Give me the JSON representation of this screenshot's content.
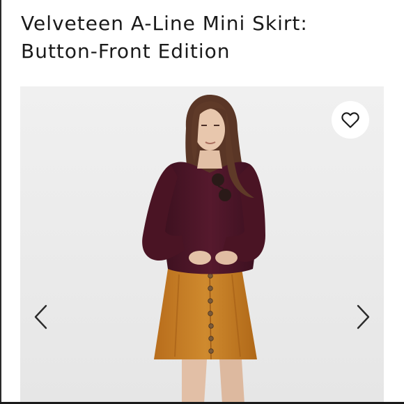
{
  "product": {
    "title_line1": "Velveteen A-Line Mini Skirt:",
    "title_line2": "Button-Front Edition"
  },
  "gallery": {
    "favorite_icon": "heart-outline-icon",
    "prev_icon": "chevron-left-icon",
    "next_icon": "chevron-right-icon"
  },
  "colors": {
    "background": "#ffffff",
    "photo_background": "#ececec",
    "sweater": "#4a1626",
    "skirt": "#c37a23",
    "text": "#1a1a1a"
  }
}
